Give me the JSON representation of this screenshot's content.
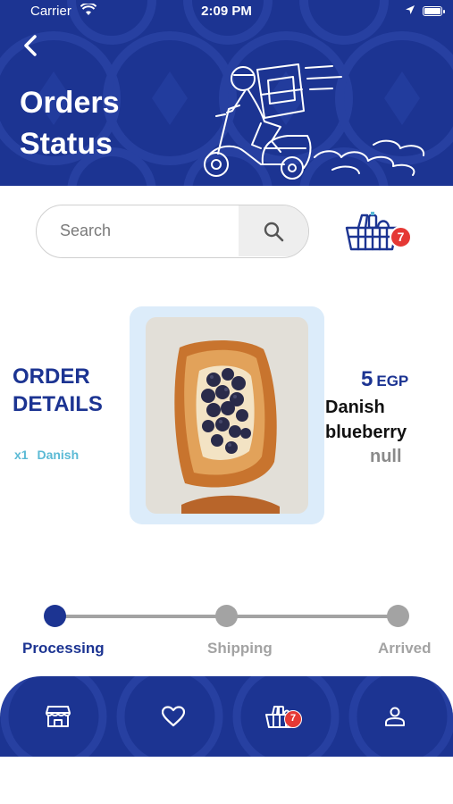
{
  "status_bar": {
    "carrier": "Carrier",
    "time": "2:09 PM"
  },
  "header": {
    "title_line1": "Orders",
    "title_line2": "Status"
  },
  "search": {
    "placeholder": "Search"
  },
  "cart": {
    "count": "7"
  },
  "order": {
    "title_line1": "ORDER",
    "title_line2": "DETAILS",
    "quantity": "x1",
    "item_short": "Danish",
    "price_value": "5",
    "currency": "EGP",
    "product_name_line1": "Danish",
    "product_name_line2": "blueberry",
    "product_sub": "null"
  },
  "progress": {
    "current_step": 1,
    "steps": [
      {
        "label": "Processing"
      },
      {
        "label": "Shipping"
      },
      {
        "label": "Arrived"
      }
    ]
  },
  "bottom_nav": {
    "items": [
      "store-icon",
      "heart-icon",
      "basket-icon",
      "user-icon"
    ],
    "cart_count": "7"
  },
  "colors": {
    "primary": "#1c3492",
    "accent": "#5bbad5",
    "badge": "#e53935",
    "inactive": "#a3a3a3",
    "card": "#dcecfa"
  }
}
